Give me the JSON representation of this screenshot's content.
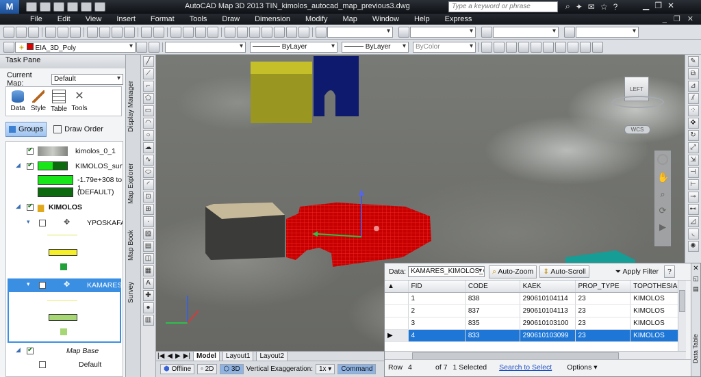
{
  "window": {
    "title": "AutoCAD Map 3D 2013  TIN_kimolos_autocad_map_previous3.dwg",
    "search_placeholder": "Type a keyword or phrase"
  },
  "menu": [
    "File",
    "Edit",
    "View",
    "Insert",
    "Format",
    "Tools",
    "Draw",
    "Dimension",
    "Modify",
    "Map",
    "Window",
    "Help",
    "Express"
  ],
  "layers_toolbar": {
    "layer_name": "EIA_3D_Poly",
    "linetype": "ByLayer",
    "lineweight": "ByLayer",
    "plotstyle": "ByColor"
  },
  "task_pane": {
    "title": "Task Pane",
    "current_map_label": "Current Map:",
    "current_map_value": "Default",
    "buttons": [
      "Data",
      "Style",
      "Table",
      "Tools"
    ],
    "groups_label": "Groups",
    "draw_order_label": "Draw Order",
    "layers": {
      "kimolos_0_1": "kimolos_0_1",
      "kimolos_surf": "KIMOLOS_surfa",
      "range": "-1.79e+308 to 1",
      "default_theme": "(DEFAULT)",
      "group_kimolos": "KIMOLOS",
      "yposkafa": "YPOSKAFA",
      "kamares": "KAMARES_",
      "map_base": "Map Base",
      "default": "Default"
    },
    "side_tabs": [
      "Display Manager",
      "Map Explorer",
      "Map Book",
      "Survey"
    ]
  },
  "viewport": {
    "viewcube_label": "LEFT",
    "wcs_label": "WCS"
  },
  "layout_tabs": [
    "Model",
    "Layout1",
    "Layout2"
  ],
  "status_bar": {
    "offline": "Offline",
    "mode_2d": "2D",
    "mode_3d": "3D",
    "vert_exag_label": "Vertical Exaggeration:",
    "vert_exag_value": "1x",
    "command": "Command"
  },
  "data_table": {
    "data_label": "Data:",
    "source": "KAMARES_KIMOLOS_CA",
    "auto_zoom": "Auto-Zoom",
    "auto_scroll": "Auto-Scroll",
    "apply_filter": "Apply Filter",
    "help": "?",
    "side_label": "Data Table",
    "columns": [
      "FID",
      "CODE",
      "KAEK",
      "PROP_TYPE",
      "TOPOTHESIA"
    ],
    "rows": [
      [
        "1",
        "838",
        "290610104114",
        "23",
        "KIMOLOS"
      ],
      [
        "2",
        "837",
        "290610104113",
        "23",
        "KIMOLOS"
      ],
      [
        "3",
        "835",
        "290610103100",
        "23",
        "KIMOLOS"
      ],
      [
        "4",
        "833",
        "290610103099",
        "23",
        "KIMOLOS"
      ]
    ],
    "selected_row_index": 3,
    "footer": {
      "row_label": "Row",
      "row_value": "4",
      "of_total": "of 7",
      "selected": "1 Selected",
      "search_to_select": "Search to Select",
      "options": "Options"
    }
  }
}
